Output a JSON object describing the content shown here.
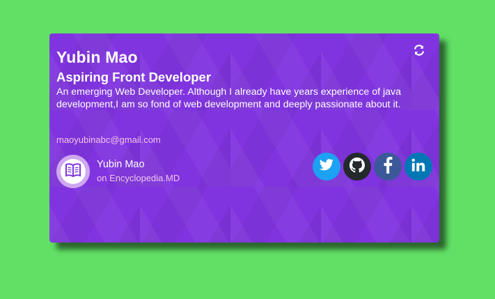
{
  "card": {
    "name": "Yubin Mao",
    "role": "Aspiring Front Developer",
    "bio": "An emerging Web Developer. Although I already have years experience of java development,I am so fond of web development and deeply passionate about it.",
    "email": "maoyubinabc@gmail.com",
    "author": {
      "name": "Yubin Mao",
      "site": "on Encyclopedia.MD"
    },
    "socials": [
      {
        "icon": "twitter-icon",
        "color": "#1da1f2"
      },
      {
        "icon": "github-icon",
        "color": "#24292e"
      },
      {
        "icon": "facebook-icon",
        "color": "#3b5998"
      },
      {
        "icon": "linkedin-icon",
        "color": "#0077b5"
      }
    ],
    "colors": {
      "background": "#62e065",
      "card": "#8034df",
      "accent_text": "#f3c4ec"
    }
  }
}
